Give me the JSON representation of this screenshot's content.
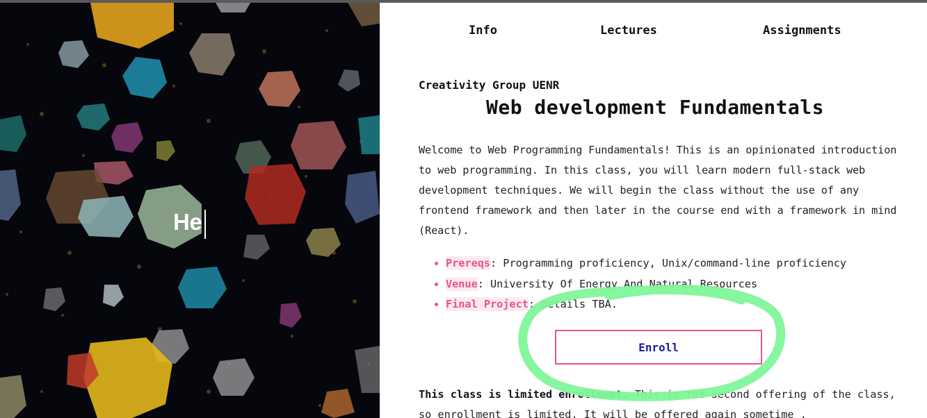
{
  "nav": {
    "info": "Info",
    "lectures": "Lectures",
    "assignments": "Assignments"
  },
  "hero": {
    "typed_text": "He"
  },
  "course": {
    "org": "Creativity Group UENR",
    "title": "Web development Fundamentals",
    "description": "Welcome to Web Programming Fundamentals! This is an opinionated introduction to web programming. In this class, you will learn modern full-stack web development techniques. We will begin the class without the use of any frontend framework and then later in the course end with a framework in mind (React).",
    "details": [
      {
        "label": "Prereqs",
        "text": ": Programming proficiency, Unix/command-line proficiency"
      },
      {
        "label": "Venue",
        "text": ": University Of Energy And Natural Resources"
      },
      {
        "label": "Final Project",
        "text": ": Details TBA."
      }
    ],
    "enroll_label": "Enroll",
    "limited_bold": "This class is limited enrollment.",
    "limited_text": " This is the second offering of the class, so enrollment is limited. It will be offered again sometime ."
  },
  "colors": {
    "accent": "#e8538a",
    "highlight_bg": "#fdeaf0",
    "button_text": "#1a1aaa",
    "annotation": "#7ff59a",
    "hero_bg": "#05070d"
  }
}
